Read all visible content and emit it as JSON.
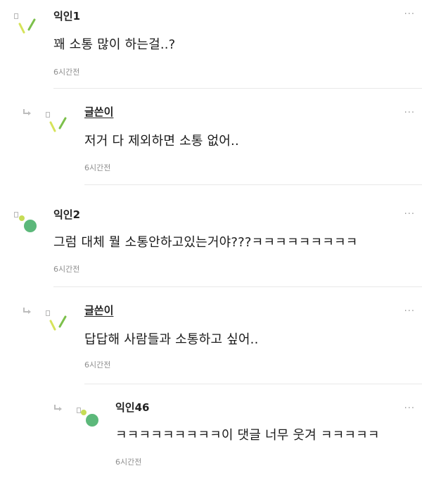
{
  "comments": [
    {
      "name": "익인1",
      "text": "꽤 소통 많이 하는걸..?",
      "time": "6시간전"
    },
    {
      "name": "글쓴이",
      "text": "저거 다 제외하면 소통 없어..",
      "time": "6시간전"
    },
    {
      "name": "익인2",
      "text": "그럼 대체 뭘 소통안하고있는거야???ㅋㅋㅋㅋㅋㅋㅋㅋㅋ",
      "time": "6시간전"
    },
    {
      "name": "글쓴이",
      "text": "답답해 사람들과 소통하고 싶어..",
      "time": "6시간전"
    },
    {
      "name": "익인46",
      "text": "ㅋㅋㅋㅋㅋㅋㅋㅋㅋ이 댓글 너무 웃겨 ㅋㅋㅋㅋㅋ",
      "time": "6시간전"
    }
  ],
  "more_label": "···",
  "colors": {
    "leaf_light": "#d6e35a",
    "leaf_dark": "#7cc04b",
    "dot_green": "#5cb87a",
    "dot_lime": "#c6dc55"
  }
}
